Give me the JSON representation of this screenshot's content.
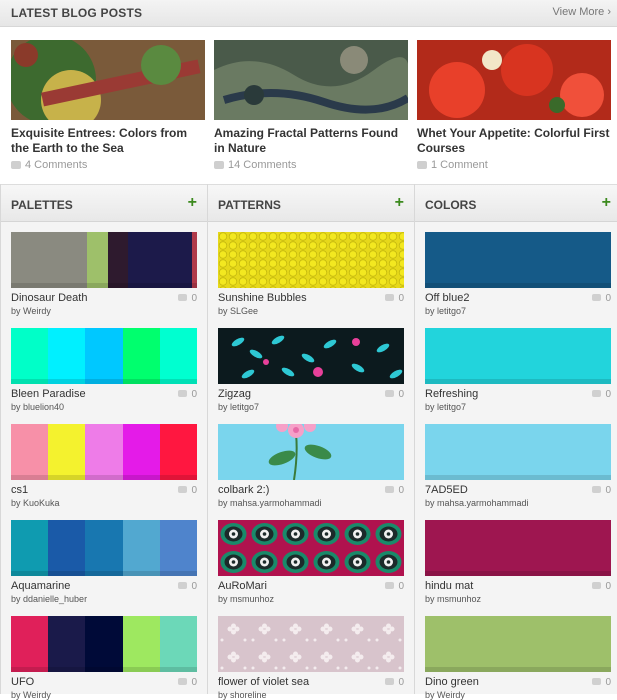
{
  "blog": {
    "title": "LATEST BLOG POSTS",
    "view_more": "View More ›",
    "posts": [
      {
        "title": "Exquisite Entrees: Colors from the Earth to the Sea",
        "comments": "4 Comments"
      },
      {
        "title": "Amazing Fractal Patterns Found in Nature",
        "comments": "14 Comments"
      },
      {
        "title": "Whet Your Appetite: Colorful First Courses",
        "comments": "1 Comment"
      }
    ]
  },
  "columns": {
    "palettes": {
      "title": "PALETTES",
      "items": [
        {
          "name": "Dinosaur Death",
          "by": "by Weirdy",
          "count": "0",
          "colors": [
            "#8a8a80",
            "#9ec06a",
            "#2e1a2e",
            "#1c1a4a",
            "#b03a4a"
          ]
        },
        {
          "name": "Bleen Paradise",
          "by": "by bluelion40",
          "count": "0",
          "colors": [
            "#00ffc8",
            "#00f0ff",
            "#00c8ff",
            "#00ff6e",
            "#00ffd0"
          ]
        },
        {
          "name": "cs1",
          "by": "by KuoKuka",
          "count": "0",
          "colors": [
            "#f790a8",
            "#f4f22e",
            "#ee7ce8",
            "#e41be8",
            "#ff1740"
          ]
        },
        {
          "name": "Aquamarine",
          "by": "by ddanielle_huber",
          "count": "0",
          "colors": [
            "#0f9bb0",
            "#1a5aa8",
            "#1877b0",
            "#52a8d0",
            "#4f84cc"
          ]
        },
        {
          "name": "UFO",
          "by": "by Weirdy",
          "count": "0",
          "colors": [
            "#e0205a",
            "#1a1a4a",
            "#000a38",
            "#9ee860",
            "#6cd8b8"
          ]
        }
      ]
    },
    "patterns": {
      "title": "PATTERNS",
      "items": [
        {
          "name": "Sunshine Bubbles",
          "by": "by SLGee",
          "count": "0"
        },
        {
          "name": "Zigzag",
          "by": "by letitgo7",
          "count": "0"
        },
        {
          "name": "colbark 2:)",
          "by": "by mahsa.yarmohammadi",
          "count": "0"
        },
        {
          "name": "AuRoMari",
          "by": "by msmunhoz",
          "count": "0"
        },
        {
          "name": "flower of violet sea",
          "by": "by shoreline",
          "count": "0"
        }
      ]
    },
    "colors": {
      "title": "COLORS",
      "items": [
        {
          "name": "Off blue2",
          "by": "by letitgo7",
          "count": "0",
          "color": "#155a88"
        },
        {
          "name": "Refreshing",
          "by": "by letitgo7",
          "count": "0",
          "color": "#22d4dc"
        },
        {
          "name": "7AD5ED",
          "by": "by mahsa.yarmohammadi",
          "count": "0",
          "color": "#7ad5ed"
        },
        {
          "name": "hindu mat",
          "by": "by msmunhoz",
          "count": "0",
          "color": "#9e1650"
        },
        {
          "name": "Dino green",
          "by": "by Weirdy",
          "count": "0",
          "color": "#9ec06a"
        }
      ]
    }
  },
  "accent": {
    "plus": "#3c8a1e"
  }
}
